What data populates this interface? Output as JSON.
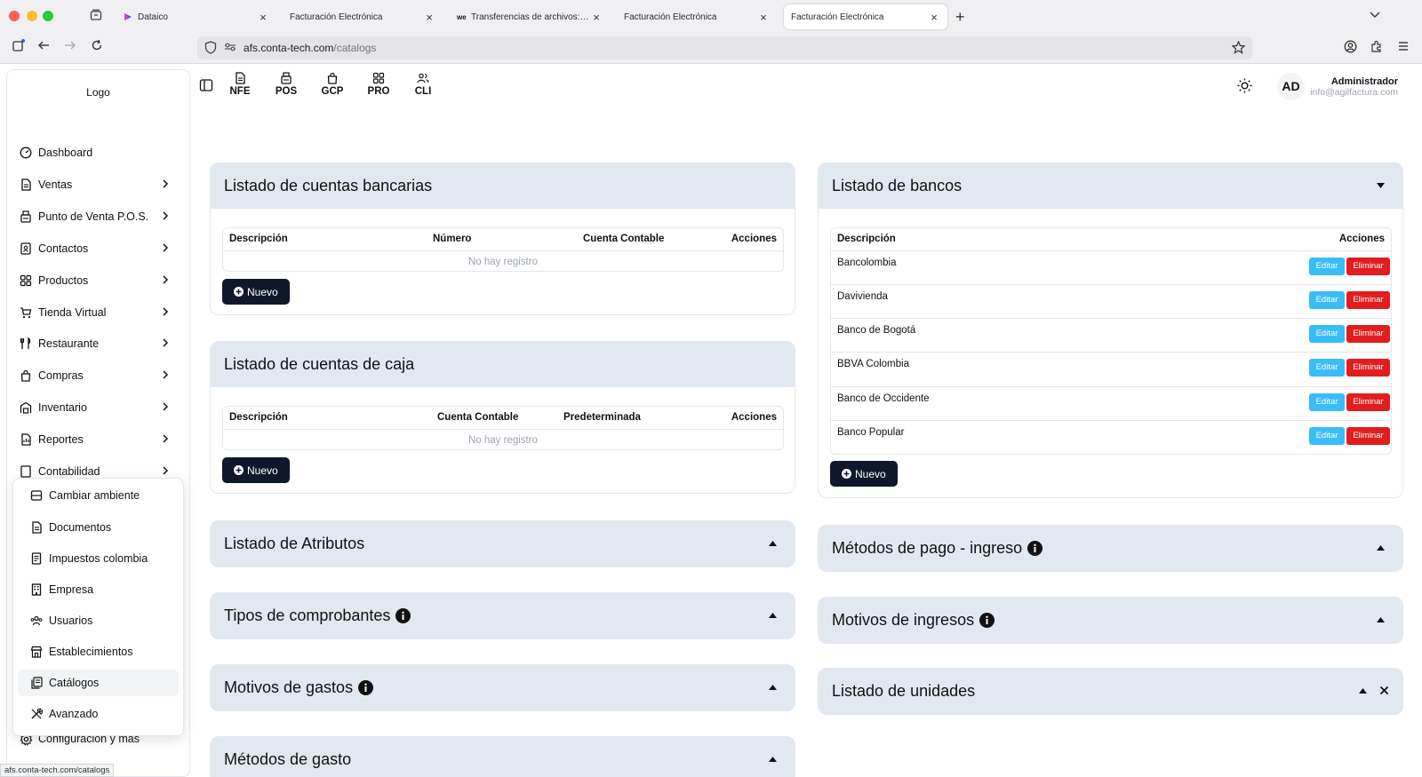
{
  "browser": {
    "tabs": [
      {
        "title": "Dataico",
        "active": false
      },
      {
        "title": "Facturación Electrónica",
        "active": false
      },
      {
        "title": "Transferencias de archivos: el c",
        "active": false
      },
      {
        "title": "Facturación Electrónica",
        "active": false
      },
      {
        "title": "Facturación Electrónica",
        "active": true
      }
    ],
    "url_domain": "afs.conta-tech.com",
    "url_path": "/catalogs",
    "status_url": "afs.conta-tech.com/catalogs"
  },
  "sidebar": {
    "logo": "Logo",
    "items": [
      {
        "label": "Dashboard",
        "icon": "dashboard-icon",
        "has_children": false
      },
      {
        "label": "Ventas",
        "icon": "document-icon",
        "has_children": true
      },
      {
        "label": "Punto de Venta P.O.S.",
        "icon": "pos-icon",
        "has_children": true
      },
      {
        "label": "Contactos",
        "icon": "contacts-icon",
        "has_children": true
      },
      {
        "label": "Productos",
        "icon": "grid-icon",
        "has_children": true
      },
      {
        "label": "Tienda Virtual",
        "icon": "cart-icon",
        "has_children": true
      },
      {
        "label": "Restaurante",
        "icon": "utensils-icon",
        "has_children": true
      },
      {
        "label": "Compras",
        "icon": "bag-icon",
        "has_children": true
      },
      {
        "label": "Inventario",
        "icon": "warehouse-icon",
        "has_children": true
      },
      {
        "label": "Reportes",
        "icon": "report-icon",
        "has_children": true
      },
      {
        "label": "Contabilidad",
        "icon": "accounting-icon",
        "has_children": true
      }
    ],
    "config_label": "Configuración y más"
  },
  "config_menu": {
    "items": [
      {
        "label": "Cambiar ambiente",
        "icon": "server-icon"
      },
      {
        "label": "Documentos",
        "icon": "document-icon"
      },
      {
        "label": "Impuestos colombia",
        "icon": "receipt-icon"
      },
      {
        "label": "Empresa",
        "icon": "building-icon"
      },
      {
        "label": "Usuarios",
        "icon": "users-icon"
      },
      {
        "label": "Establecimientos",
        "icon": "store-icon"
      },
      {
        "label": "Catálogos",
        "icon": "catalog-icon",
        "active": true
      },
      {
        "label": "Avanzado",
        "icon": "tools-icon"
      }
    ]
  },
  "topbar": {
    "modules": [
      {
        "label": "NFE",
        "icon": "document-icon"
      },
      {
        "label": "POS",
        "icon": "pos-icon"
      },
      {
        "label": "GCP",
        "icon": "bag-icon"
      },
      {
        "label": "PRO",
        "icon": "grid-icon"
      },
      {
        "label": "CLI",
        "icon": "users-icon"
      }
    ],
    "user": {
      "initials": "AD",
      "name": "Administrador",
      "email": "info@agilfactura.com"
    }
  },
  "cuentas_bancarias": {
    "title": "Listado de cuentas bancarias",
    "columns": [
      "Descripción",
      "Número",
      "Cuenta Contable",
      "Acciones"
    ],
    "empty": "No hay registro",
    "new_label": "Nuevo"
  },
  "cuentas_caja": {
    "title": "Listado de cuentas de caja",
    "columns": [
      "Descripción",
      "Cuenta Contable",
      "Predeterminada",
      "Acciones"
    ],
    "empty": "No hay registro",
    "new_label": "Nuevo"
  },
  "bancos": {
    "title": "Listado de bancos",
    "columns": [
      "Descripción",
      "Acciones"
    ],
    "rows": [
      "Bancolombia",
      "Davivienda",
      "Banco de Bogotá",
      "BBVA Colombia",
      "Banco de Occidente",
      "Banco Popular"
    ],
    "edit_label": "Editar",
    "delete_label": "Eliminar",
    "new_label": "Nuevo"
  },
  "collapsed_left": [
    "Listado de Atributos",
    "Tipos de comprobantes",
    "Motivos de gastos",
    "Métodos de gasto"
  ],
  "collapsed_right": [
    "Métodos de pago - ingreso",
    "Motivos de ingresos",
    "Listado de unidades"
  ],
  "colors": {
    "header_bg": "#e2e8f0",
    "primary_dark": "#0f172a",
    "edit": "#38bdf8",
    "delete": "#e11d1d"
  }
}
